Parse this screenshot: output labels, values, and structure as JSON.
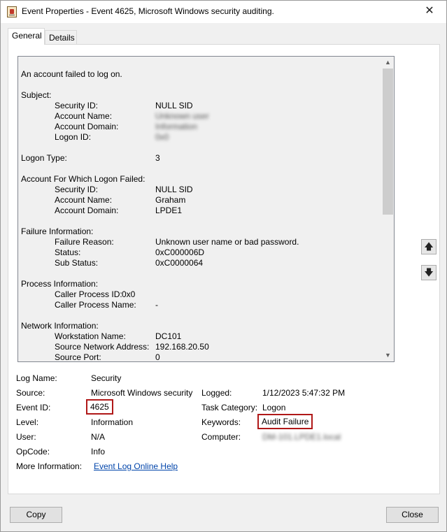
{
  "window": {
    "title": "Event Properties - Event 4625, Microsoft Windows security auditing.",
    "close_glyph": "✕"
  },
  "tabs": [
    {
      "label": "General",
      "active": true
    },
    {
      "label": "Details",
      "active": false
    }
  ],
  "description": {
    "headline": "An account failed to log on.",
    "subject": {
      "header": "Subject:",
      "security_id_label": "Security ID:",
      "security_id": "NULL SID",
      "account_name_label": "Account Name:",
      "account_name": "Unknown user",
      "account_domain_label": "Account Domain:",
      "account_domain": "Information",
      "logon_id_label": "Logon ID:",
      "logon_id": "0x0"
    },
    "logon_type_label": "Logon Type:",
    "logon_type": "3",
    "failed_account": {
      "header": "Account For Which Logon Failed:",
      "security_id_label": "Security ID:",
      "security_id": "NULL SID",
      "account_name_label": "Account Name:",
      "account_name": "Graham",
      "account_domain_label": "Account Domain:",
      "account_domain": "LPDE1"
    },
    "failure": {
      "header": "Failure Information:",
      "reason_label": "Failure Reason:",
      "reason": "Unknown user name or bad password.",
      "status_label": "Status:",
      "status": "0xC000006D",
      "sub_status_label": "Sub Status:",
      "sub_status": "0xC0000064"
    },
    "process": {
      "header": "Process Information:",
      "caller_pid_label": "Caller Process ID:",
      "caller_pid": "0x0",
      "caller_name_label": "Caller Process Name:",
      "caller_name": "-"
    },
    "network": {
      "header": "Network Information:",
      "workstation_label": "Workstation Name:",
      "workstation": "DC101",
      "source_address_label": "Source Network Address:",
      "source_address": "192.168.20.50",
      "source_port_label": "Source Port:",
      "source_port": "0"
    }
  },
  "details": {
    "log_name_label": "Log Name:",
    "log_name": "Security",
    "source_label": "Source:",
    "source": "Microsoft Windows security",
    "logged_label": "Logged:",
    "logged": "1/12/2023 5:47:32 PM",
    "event_id_label": "Event ID:",
    "event_id": "4625",
    "task_category_label": "Task Category:",
    "task_category": "Logon",
    "level_label": "Level:",
    "level": "Information",
    "keywords_label": "Keywords:",
    "keywords": "Audit Failure",
    "user_label": "User:",
    "user": "N/A",
    "computer_label": "Computer:",
    "computer": "DM-101.LPDE1.local",
    "opcode_label": "OpCode:",
    "opcode": "Info",
    "more_info_label": "More Information:",
    "more_info_link": "Event Log Online Help"
  },
  "buttons": {
    "copy": "Copy",
    "close": "Close",
    "scroll_up_glyph": "🡅",
    "scroll_down_glyph": "🡇"
  },
  "colors": {
    "highlight_border": "#b01818",
    "link": "#0044aa"
  }
}
